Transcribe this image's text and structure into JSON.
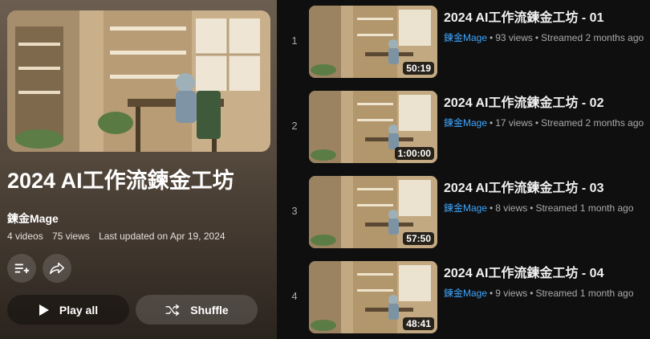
{
  "playlist": {
    "title": "2024 AI工作流鍊金工坊",
    "channel": "鍊金Mage",
    "video_count": "4 videos",
    "views": "75 views",
    "updated": "Last updated on Apr 19, 2024",
    "save_icon": "playlist-add-icon",
    "share_icon": "share-icon",
    "play_all_label": "Play all",
    "shuffle_label": "Shuffle"
  },
  "videos": [
    {
      "index": "1",
      "title": "2024 AI工作流鍊金工坊 - 01",
      "channel": "鍊金Mage",
      "views": "93 views",
      "streamed": "Streamed 2 months ago",
      "duration": "50:19"
    },
    {
      "index": "2",
      "title": "2024 AI工作流鍊金工坊 - 02",
      "channel": "鍊金Mage",
      "views": "17 views",
      "streamed": "Streamed 2 months ago",
      "duration": "1:00:00"
    },
    {
      "index": "3",
      "title": "2024 AI工作流鍊金工坊 - 03",
      "channel": "鍊金Mage",
      "views": "8 views",
      "streamed": "Streamed 1 month ago",
      "duration": "57:50"
    },
    {
      "index": "4",
      "title": "2024 AI工作流鍊金工坊 - 04",
      "channel": "鍊金Mage",
      "views": "9 views",
      "streamed": "Streamed 1 month ago",
      "duration": "48:41"
    }
  ],
  "colors": {
    "link": "#3ea6ff",
    "background": "#0f0f0f",
    "meta": "#aaaaaa"
  }
}
